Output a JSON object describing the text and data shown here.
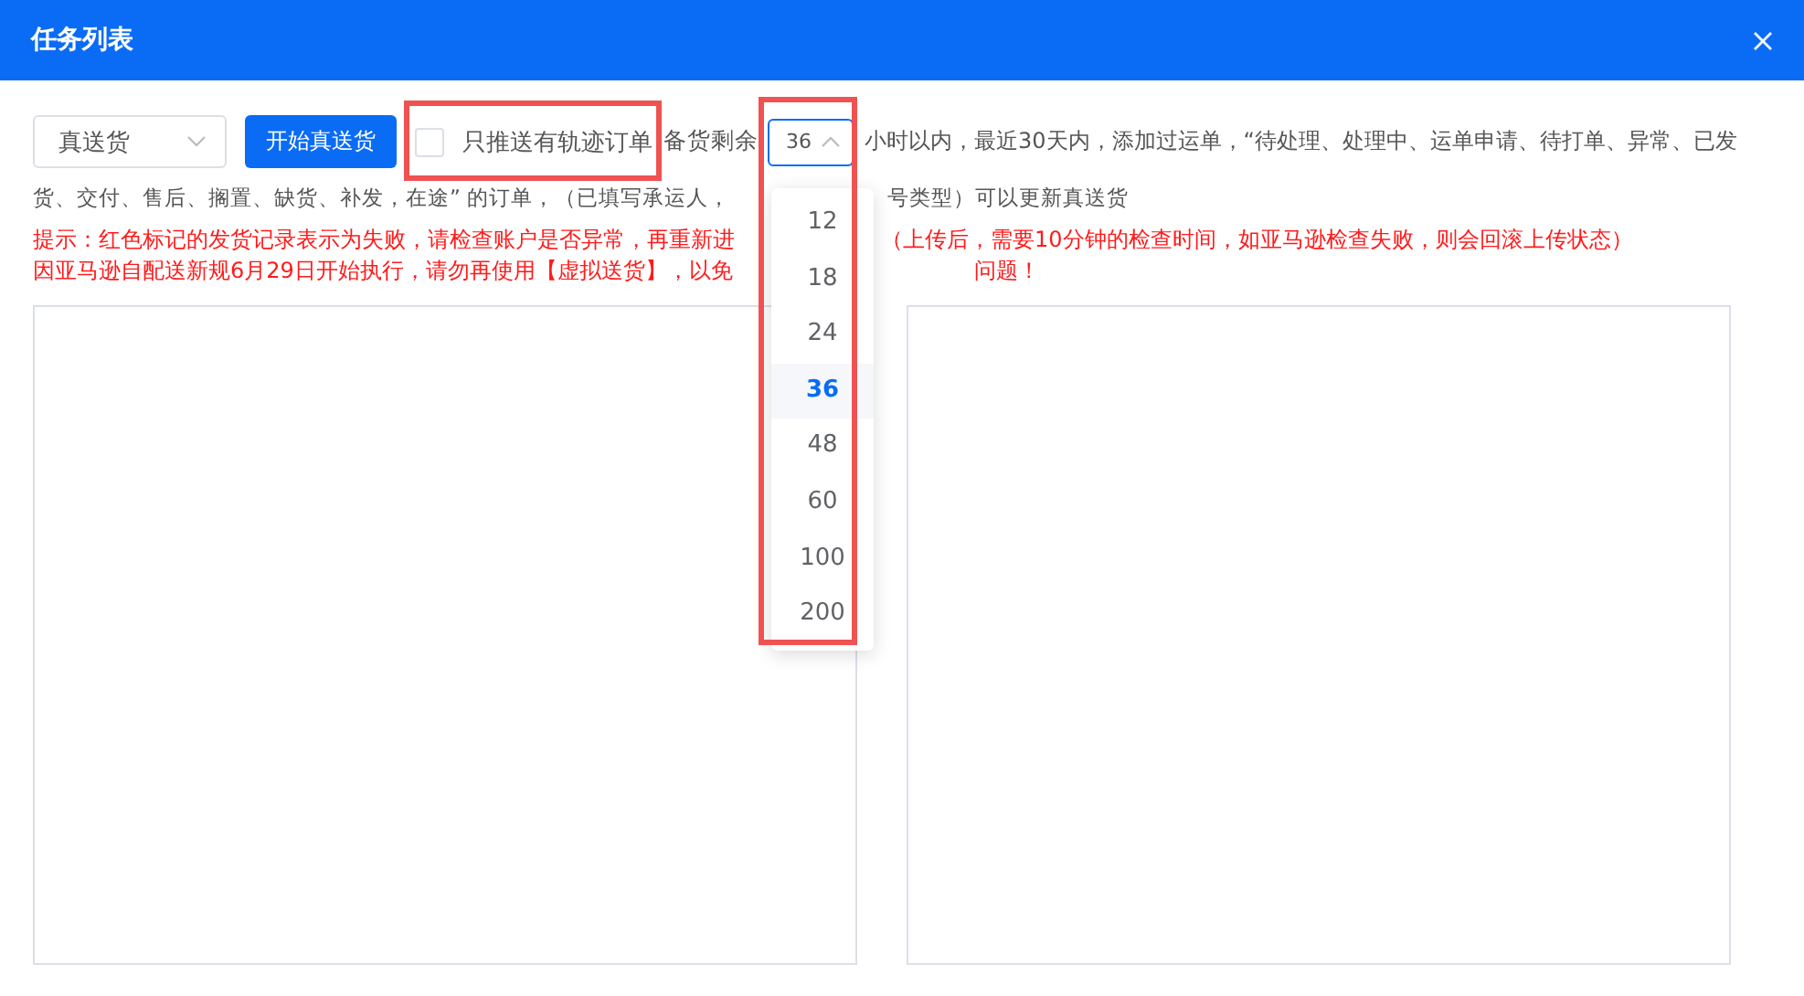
{
  "window": {
    "title": "任务列表"
  },
  "toolbar": {
    "mode_select": {
      "value": "真送货"
    },
    "start_button": "开始真送货",
    "track_only": {
      "label": "只推送有轨迹订单",
      "checked": false
    },
    "stock_label": "备货剩余",
    "hours_select": {
      "value": "36",
      "expanded": true
    }
  },
  "description": {
    "line_1": "小时以内，最近30天内，添加过运单，“待处理、处理中、运单申请、待打单、异常、已发",
    "line_2_parts": [
      "货、交付、售后、搁置、缺货、补发，在途” 的订单，（已填写承运人，",
      "号类型）可以更新真送货"
    ]
  },
  "notice_lines": [
    {
      "parts": [
        "提示：红色标记的发货记录表示为失败，请检查账户是否异常，再重新进",
        "（上传后，需要10分钟的检查时间，如亚马逊检查失败，则会回滚上传状态）"
      ]
    },
    {
      "parts": [
        "因亚马逊自配送新规6月29日开始执行，请勿再使用【虚拟送货】，以免",
        "问题！"
      ]
    }
  ],
  "hours_dropdown": {
    "options": [
      {
        "label": "12",
        "selected": false
      },
      {
        "label": "18",
        "selected": false
      },
      {
        "label": "24",
        "selected": false
      },
      {
        "label": "36",
        "selected": true
      },
      {
        "label": "48",
        "selected": false
      },
      {
        "label": "60",
        "selected": false
      },
      {
        "label": "100",
        "selected": false
      },
      {
        "label": "200",
        "selected": false
      }
    ]
  }
}
